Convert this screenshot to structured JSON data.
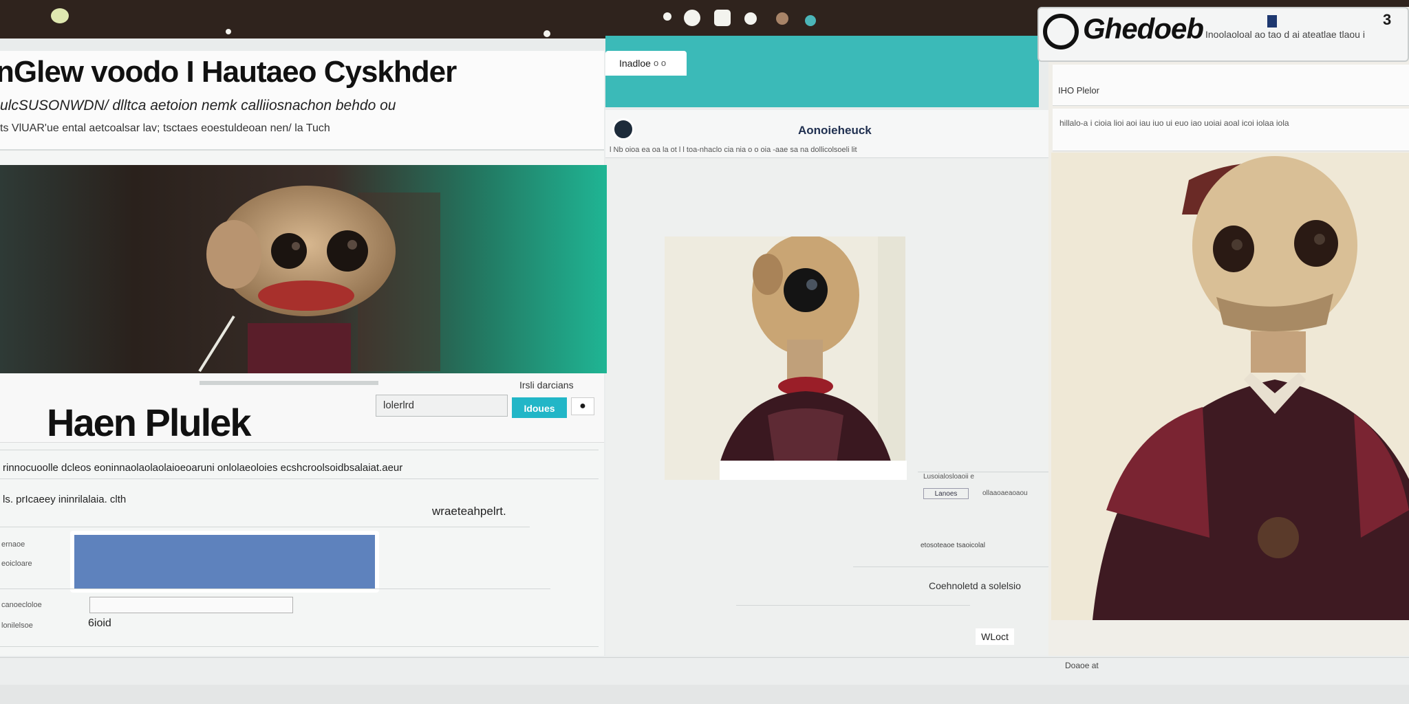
{
  "left": {
    "headline": "nGlew voodo I Hautaeo Cyskhder",
    "sub1": "ulcSUSONWDN/ dlltca aetoion nemk  calliiosnachon behdo ou",
    "sub2": "ts VlUAR'ue ental  aetcoalsar lav; tsctaes eoestuldeoan nen/ la Tuch",
    "profile_name": "Haen Plulek",
    "top_right": "Irsli darcians",
    "input_value": "lolerlrd",
    "button_label": "Idoues",
    "desc": "rinnocuoolle dcleos eoninnaolaolaolaioeoaruni  onlolaeoloies ecshcroolsoidbsalaiat.aeur",
    "desc2": "ls. prIcaeey ininrilalaia. clth",
    "desc_right": "wraeteahpelrt.",
    "count": "6ioid",
    "side_labels": [
      "ernaoe",
      "eoicloare",
      "canoecloloe",
      "lonilelsoe"
    ]
  },
  "middle": {
    "tab_label": "Inadloe",
    "tab_close": "o o",
    "title": "Aonoieheuck",
    "crumb": "l Nb oioa ea oa la ot  l l  toa-nhaclo cia nia  o o oia -aae sa na dollicolsoeli lit",
    "caption1": "Lusoialosloaoii e",
    "chip": "Lanoes",
    "chip2": "ollaaoaeaoaou",
    "caption2": "etosoteaoe tsaoicolal",
    "footer_label": "Coehnoletd a solelsio",
    "footer_button": "WLoct"
  },
  "right": {
    "logo": "Ghedoeb",
    "meta": "Inoolaoloal ao tao d ai ateatlae tlaou  i",
    "number": "3",
    "label1": "IHO Plelor",
    "label2": "hillalo-a i cioia lioi aoi iau iuo ui euo iao uoiai aoal icoi iolaa iola"
  },
  "bottom": {
    "status": "Doaoe at"
  }
}
